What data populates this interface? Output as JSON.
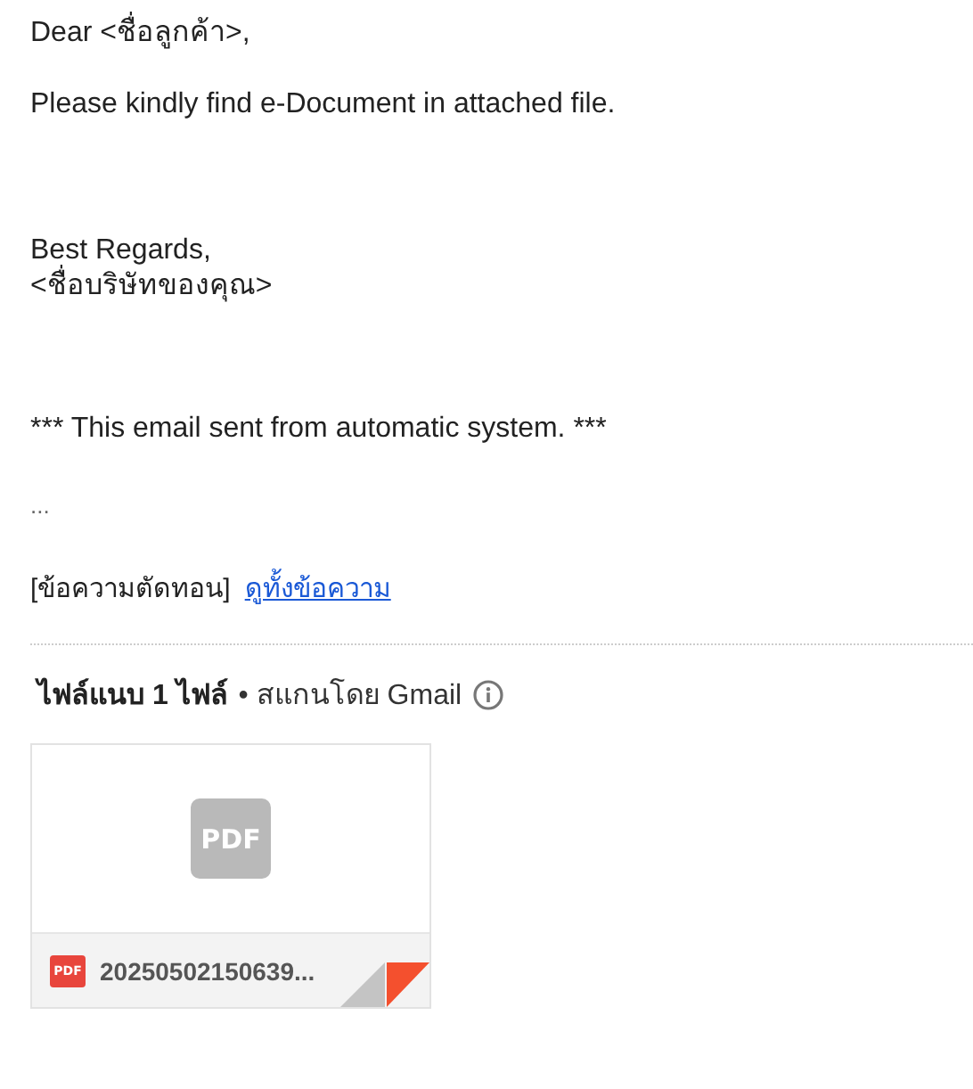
{
  "message": {
    "greeting": "Dear <ชื่อลูกค้า>,",
    "body": "Please kindly find e-Document in attached file.",
    "closing": "Best Regards,",
    "signature": "<ชื่อบริษัทของคุณ>",
    "footer": "*** This email sent from automatic system. ***",
    "ellipsis": "...",
    "clipped_note": "[ข้อความตัดทอน]",
    "view_all_link": "ดูทั้งข้อความ"
  },
  "attachments": {
    "heading": "ไฟล์แนบ 1 ไฟล์",
    "scan_note": "• สแกนโดย Gmail",
    "files": [
      {
        "thumbnail_label": "PDF",
        "type_label": "PDF",
        "name": "20250502150639..."
      }
    ]
  }
}
